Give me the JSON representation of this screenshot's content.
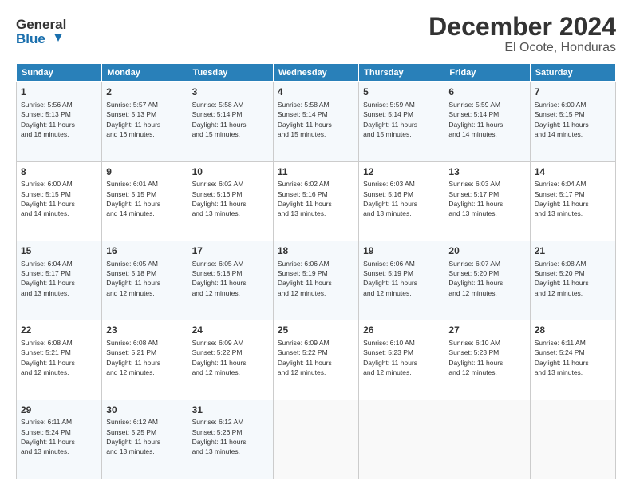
{
  "header": {
    "logo_line1": "General",
    "logo_line2": "Blue",
    "main_title": "December 2024",
    "subtitle": "El Ocote, Honduras"
  },
  "calendar": {
    "days_of_week": [
      "Sunday",
      "Monday",
      "Tuesday",
      "Wednesday",
      "Thursday",
      "Friday",
      "Saturday"
    ],
    "weeks": [
      [
        {
          "day": "",
          "info": ""
        },
        {
          "day": "2",
          "info": "Sunrise: 5:57 AM\nSunset: 5:13 PM\nDaylight: 11 hours\nand 16 minutes."
        },
        {
          "day": "3",
          "info": "Sunrise: 5:58 AM\nSunset: 5:14 PM\nDaylight: 11 hours\nand 15 minutes."
        },
        {
          "day": "4",
          "info": "Sunrise: 5:58 AM\nSunset: 5:14 PM\nDaylight: 11 hours\nand 15 minutes."
        },
        {
          "day": "5",
          "info": "Sunrise: 5:59 AM\nSunset: 5:14 PM\nDaylight: 11 hours\nand 15 minutes."
        },
        {
          "day": "6",
          "info": "Sunrise: 5:59 AM\nSunset: 5:14 PM\nDaylight: 11 hours\nand 14 minutes."
        },
        {
          "day": "7",
          "info": "Sunrise: 6:00 AM\nSunset: 5:15 PM\nDaylight: 11 hours\nand 14 minutes."
        }
      ],
      [
        {
          "day": "1",
          "info": "Sunrise: 5:56 AM\nSunset: 5:13 PM\nDaylight: 11 hours\nand 16 minutes.",
          "first": true
        },
        {
          "day": "9",
          "info": "Sunrise: 6:01 AM\nSunset: 5:15 PM\nDaylight: 11 hours\nand 14 minutes."
        },
        {
          "day": "10",
          "info": "Sunrise: 6:02 AM\nSunset: 5:16 PM\nDaylight: 11 hours\nand 13 minutes."
        },
        {
          "day": "11",
          "info": "Sunrise: 6:02 AM\nSunset: 5:16 PM\nDaylight: 11 hours\nand 13 minutes."
        },
        {
          "day": "12",
          "info": "Sunrise: 6:03 AM\nSunset: 5:16 PM\nDaylight: 11 hours\nand 13 minutes."
        },
        {
          "day": "13",
          "info": "Sunrise: 6:03 AM\nSunset: 5:17 PM\nDaylight: 11 hours\nand 13 minutes."
        },
        {
          "day": "14",
          "info": "Sunrise: 6:04 AM\nSunset: 5:17 PM\nDaylight: 11 hours\nand 13 minutes."
        }
      ],
      [
        {
          "day": "8",
          "info": "Sunrise: 6:00 AM\nSunset: 5:15 PM\nDaylight: 11 hours\nand 14 minutes."
        },
        {
          "day": "16",
          "info": "Sunrise: 6:05 AM\nSunset: 5:18 PM\nDaylight: 11 hours\nand 12 minutes."
        },
        {
          "day": "17",
          "info": "Sunrise: 6:05 AM\nSunset: 5:18 PM\nDaylight: 11 hours\nand 12 minutes."
        },
        {
          "day": "18",
          "info": "Sunrise: 6:06 AM\nSunset: 5:19 PM\nDaylight: 11 hours\nand 12 minutes."
        },
        {
          "day": "19",
          "info": "Sunrise: 6:06 AM\nSunset: 5:19 PM\nDaylight: 11 hours\nand 12 minutes."
        },
        {
          "day": "20",
          "info": "Sunrise: 6:07 AM\nSunset: 5:20 PM\nDaylight: 11 hours\nand 12 minutes."
        },
        {
          "day": "21",
          "info": "Sunrise: 6:08 AM\nSunset: 5:20 PM\nDaylight: 11 hours\nand 12 minutes."
        }
      ],
      [
        {
          "day": "15",
          "info": "Sunrise: 6:04 AM\nSunset: 5:17 PM\nDaylight: 11 hours\nand 13 minutes."
        },
        {
          "day": "23",
          "info": "Sunrise: 6:08 AM\nSunset: 5:21 PM\nDaylight: 11 hours\nand 12 minutes."
        },
        {
          "day": "24",
          "info": "Sunrise: 6:09 AM\nSunset: 5:22 PM\nDaylight: 11 hours\nand 12 minutes."
        },
        {
          "day": "25",
          "info": "Sunrise: 6:09 AM\nSunset: 5:22 PM\nDaylight: 11 hours\nand 12 minutes."
        },
        {
          "day": "26",
          "info": "Sunrise: 6:10 AM\nSunset: 5:23 PM\nDaylight: 11 hours\nand 12 minutes."
        },
        {
          "day": "27",
          "info": "Sunrise: 6:10 AM\nSunset: 5:23 PM\nDaylight: 11 hours\nand 12 minutes."
        },
        {
          "day": "28",
          "info": "Sunrise: 6:11 AM\nSunset: 5:24 PM\nDaylight: 11 hours\nand 13 minutes."
        }
      ],
      [
        {
          "day": "22",
          "info": "Sunrise: 6:08 AM\nSunset: 5:21 PM\nDaylight: 11 hours\nand 12 minutes."
        },
        {
          "day": "30",
          "info": "Sunrise: 6:12 AM\nSunset: 5:25 PM\nDaylight: 11 hours\nand 13 minutes."
        },
        {
          "day": "31",
          "info": "Sunrise: 6:12 AM\nSunset: 5:26 PM\nDaylight: 11 hours\nand 13 minutes."
        },
        {
          "day": "",
          "info": ""
        },
        {
          "day": "",
          "info": ""
        },
        {
          "day": "",
          "info": ""
        },
        {
          "day": "",
          "info": ""
        }
      ],
      [
        {
          "day": "29",
          "info": "Sunrise: 6:11 AM\nSunset: 5:24 PM\nDaylight: 11 hours\nand 13 minutes."
        },
        {
          "day": "",
          "info": ""
        },
        {
          "day": "",
          "info": ""
        },
        {
          "day": "",
          "info": ""
        },
        {
          "day": "",
          "info": ""
        },
        {
          "day": "",
          "info": ""
        },
        {
          "day": "",
          "info": ""
        }
      ]
    ]
  }
}
